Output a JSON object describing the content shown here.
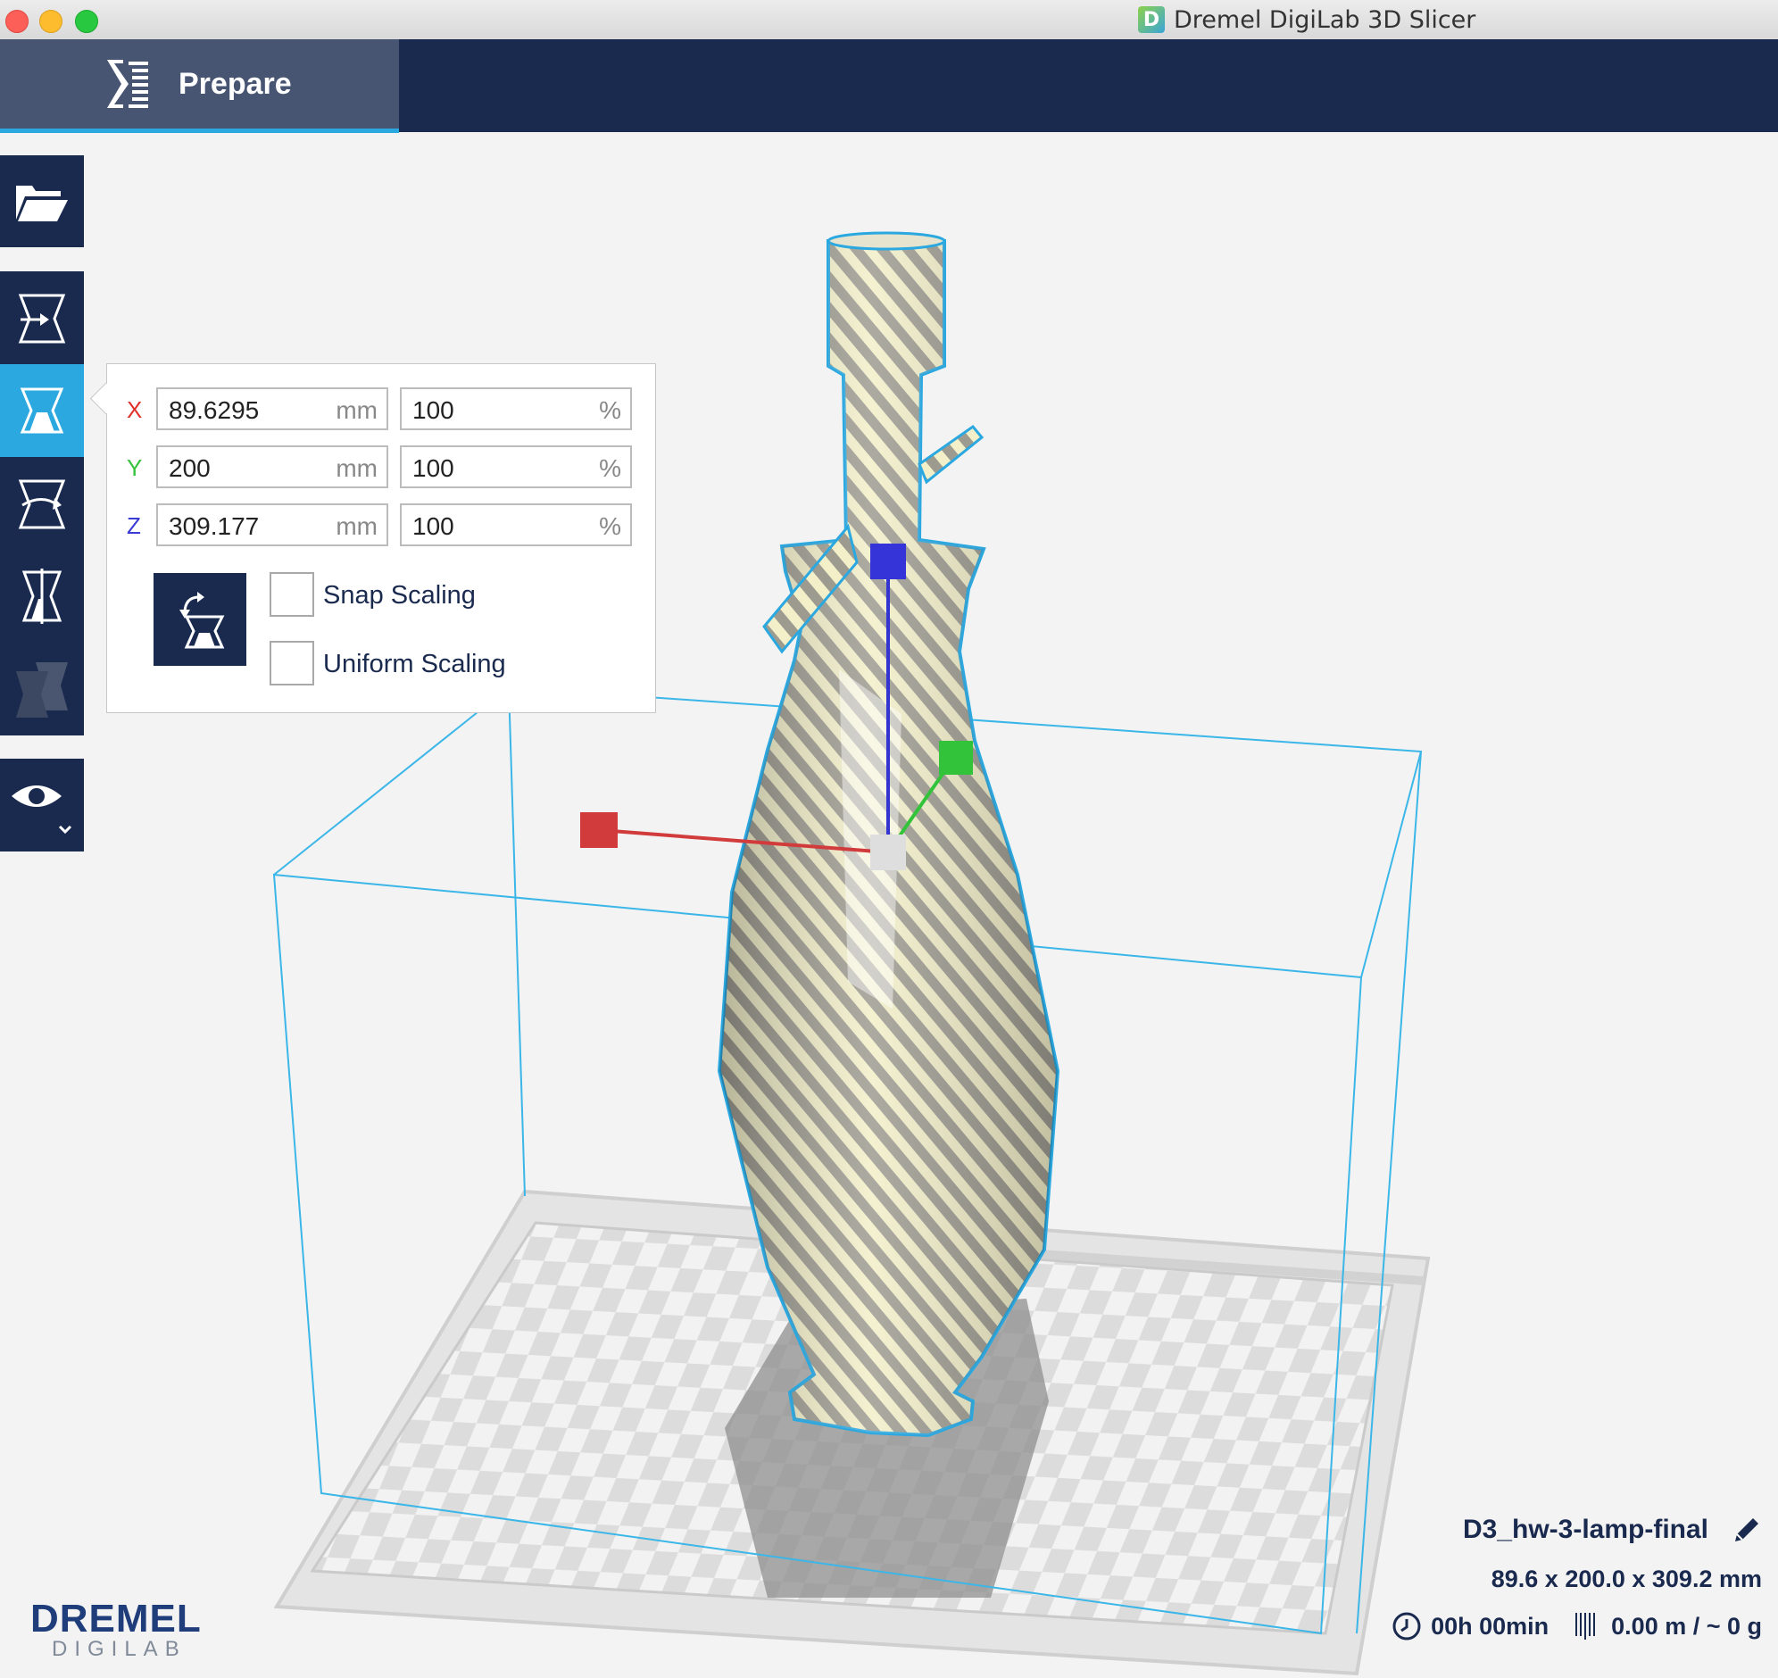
{
  "window": {
    "title": "Dremel DigiLab 3D Slicer",
    "badge": "D"
  },
  "header": {
    "tab_label": "Prepare"
  },
  "toolbar": {
    "items": [
      {
        "name": "open-file",
        "icon": "folder-open-icon"
      },
      {
        "name": "move",
        "icon": "move-icon"
      },
      {
        "name": "scale",
        "icon": "scale-icon",
        "active": true
      },
      {
        "name": "rotate",
        "icon": "rotate-icon"
      },
      {
        "name": "mirror",
        "icon": "mirror-icon"
      },
      {
        "name": "per-model-settings",
        "icon": "per-model-settings-icon",
        "disabled": true
      },
      {
        "name": "view-mode",
        "icon": "eye-icon"
      }
    ]
  },
  "scale_panel": {
    "rows": [
      {
        "axis": "X",
        "color": "#e0302a",
        "mm": "89.6295",
        "mm_unit": "mm",
        "pct": "100",
        "pct_unit": "%"
      },
      {
        "axis": "Y",
        "color": "#35c23c",
        "mm": "200",
        "mm_unit": "mm",
        "pct": "100",
        "pct_unit": "%"
      },
      {
        "axis": "Z",
        "color": "#3a3ad6",
        "mm": "309.177",
        "mm_unit": "mm",
        "pct": "100",
        "pct_unit": "%"
      }
    ],
    "snap_label": "Snap Scaling",
    "snap_checked": false,
    "uniform_label": "Uniform Scaling",
    "uniform_checked": false
  },
  "job": {
    "name": "D3_hw-3-lamp-final",
    "dimensions": "89.6 x 200.0 x 309.2 mm",
    "time": "00h 00min",
    "material": "0.00 m / ~ 0 g"
  },
  "brand": {
    "line1": "DREMEL",
    "line2": "DIGILAB"
  },
  "colors": {
    "navy": "#1a2a4f",
    "accent": "#2ba8e0",
    "panel_bg": "#ffffff"
  }
}
